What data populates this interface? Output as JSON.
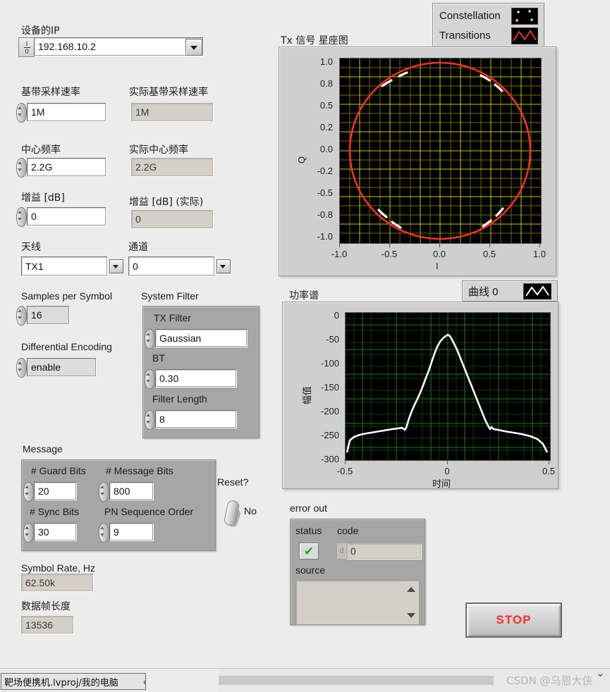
{
  "device": {
    "ip_label": "设备的IP",
    "ip_value": "192.168.10.2",
    "io_glyph_top": "I",
    "io_glyph_bottom": "0"
  },
  "rates": {
    "baseband_label": "基带采样速率",
    "baseband_value": "1M",
    "baseband_actual_label": "实际基带采样速率",
    "baseband_actual_value": "1M",
    "center_freq_label": "中心频率",
    "center_freq_value": "2.2G",
    "center_freq_actual_label": "实际中心频率",
    "center_freq_actual_value": "2.2G",
    "gain_label": "增益 [dB]",
    "gain_value": "0",
    "gain_actual_label": "增益 [dB] (实际)",
    "gain_actual_value": "0"
  },
  "rf": {
    "antenna_label": "天线",
    "antenna_value": "TX1",
    "channel_label": "通道",
    "channel_value": "0"
  },
  "modulation": {
    "samples_per_symbol_label": "Samples per Symbol",
    "samples_per_symbol_value": "16",
    "differential_encoding_label": "Differential Encoding",
    "differential_encoding_value": "enable"
  },
  "system_filter": {
    "group_label": "System Filter",
    "tx_filter_label": "TX Filter",
    "tx_filter_value": "Gaussian",
    "bt_label": "BT",
    "bt_value": "0.30",
    "filter_length_label": "Filter Length",
    "filter_length_value": "8"
  },
  "message": {
    "group_label": "Message",
    "guard_bits_label": "# Guard Bits",
    "guard_bits_value": "20",
    "message_bits_label": "# Message Bits",
    "message_bits_value": "800",
    "sync_bits_label": "# Sync Bits",
    "sync_bits_value": "30",
    "pn_order_label": "PN Sequence Order",
    "pn_order_value": "9",
    "reset_label": "Reset?",
    "reset_value": "No"
  },
  "readouts": {
    "symbol_rate_label": "Symbol Rate, Hz",
    "symbol_rate_value": "62.50k",
    "frame_length_label": "数据帧长度",
    "frame_length_value": "13536"
  },
  "error_out": {
    "group_label": "error out",
    "status_label": "status",
    "status_value": "ok",
    "code_label": "code",
    "code_prefix": "d",
    "code_value": "0",
    "source_label": "source",
    "source_value": ""
  },
  "stop_button": {
    "label": "STOP"
  },
  "constellation": {
    "title": "Tx 信号 星座图",
    "legend": [
      {
        "name": "Constellation",
        "icon": "scatter-dots-icon"
      },
      {
        "name": "Transitions",
        "icon": "zigzag-line-icon"
      }
    ]
  },
  "spectrum": {
    "title": "功率谱",
    "legend": [
      {
        "name": "曲线 0",
        "icon": "zigzag-line-icon"
      }
    ]
  },
  "statusbar": {
    "project": "靶场便携机.lvproj/我的电脑",
    "back_arrow": "‹",
    "watermark": "CSDN @乌恩大侠",
    "chevron": "⌄"
  },
  "colors": {
    "panel_bg": "#ececec",
    "cluster_bg": "#a6a6a6",
    "plot_bg": "#000000",
    "constellation_grid": "#c8c800",
    "constellation_trace": "#ee3322",
    "constellation_points": "#ffffff",
    "spectrum_grid": "#1f7a1f",
    "spectrum_trace": "#ffffff",
    "stop_text": "#ff2d2d",
    "status_ok": "#00b500"
  },
  "chart_data": [
    {
      "type": "scatter",
      "title": "Tx 信号 星座图",
      "xlabel": "I",
      "ylabel": "Q",
      "xlim": [
        -1.0,
        1.0
      ],
      "ylim": [
        -1.0,
        1.0
      ],
      "xticks": [
        "-1.0",
        "-0.5",
        "0.0",
        "0.5",
        "1.0"
      ],
      "yticks": [
        "1.0",
        "0.8",
        "0.5",
        "0.2",
        "0.0",
        "-0.2",
        "-0.5",
        "-0.8",
        "-1.0"
      ],
      "grid": true,
      "legend_position": "top-right",
      "series": [
        {
          "name": "Transitions",
          "kind": "line",
          "color": "#ee3322",
          "description": "Unit circle of constant-envelope GMSK transitions",
          "radius": 1.0
        },
        {
          "name": "Constellation",
          "kind": "points",
          "color": "#ffffff",
          "points": [
            [
              -0.71,
              0.71
            ],
            [
              0.71,
              0.71
            ],
            [
              -0.71,
              -0.71
            ],
            [
              0.71,
              -0.71
            ]
          ]
        }
      ]
    },
    {
      "type": "line",
      "title": "功率谱",
      "xlabel": "时间",
      "ylabel": "幅值",
      "xlim": [
        -0.5,
        0.5
      ],
      "ylim": [
        -300,
        0
      ],
      "xticks": [
        "-0.5",
        "0",
        "0.5"
      ],
      "yticks": [
        "0",
        "-50",
        "-100",
        "-150",
        "-200",
        "-250",
        "-300"
      ],
      "grid": true,
      "legend_position": "top-right",
      "series": [
        {
          "name": "曲线 0",
          "color": "#ffffff",
          "x": [
            -0.5,
            -0.45,
            -0.4,
            -0.35,
            -0.3,
            -0.25,
            -0.2,
            -0.16,
            -0.12,
            -0.08,
            -0.04,
            0.0,
            0.04,
            0.08,
            0.12,
            0.16,
            0.2,
            0.25,
            0.3,
            0.35,
            0.4,
            0.45,
            0.5
          ],
          "values": [
            -285,
            -258,
            -252,
            -248,
            -244,
            -240,
            -237,
            -210,
            -165,
            -115,
            -60,
            -26,
            -58,
            -110,
            -160,
            -205,
            -236,
            -240,
            -244,
            -248,
            -252,
            -258,
            -285
          ]
        }
      ]
    }
  ]
}
